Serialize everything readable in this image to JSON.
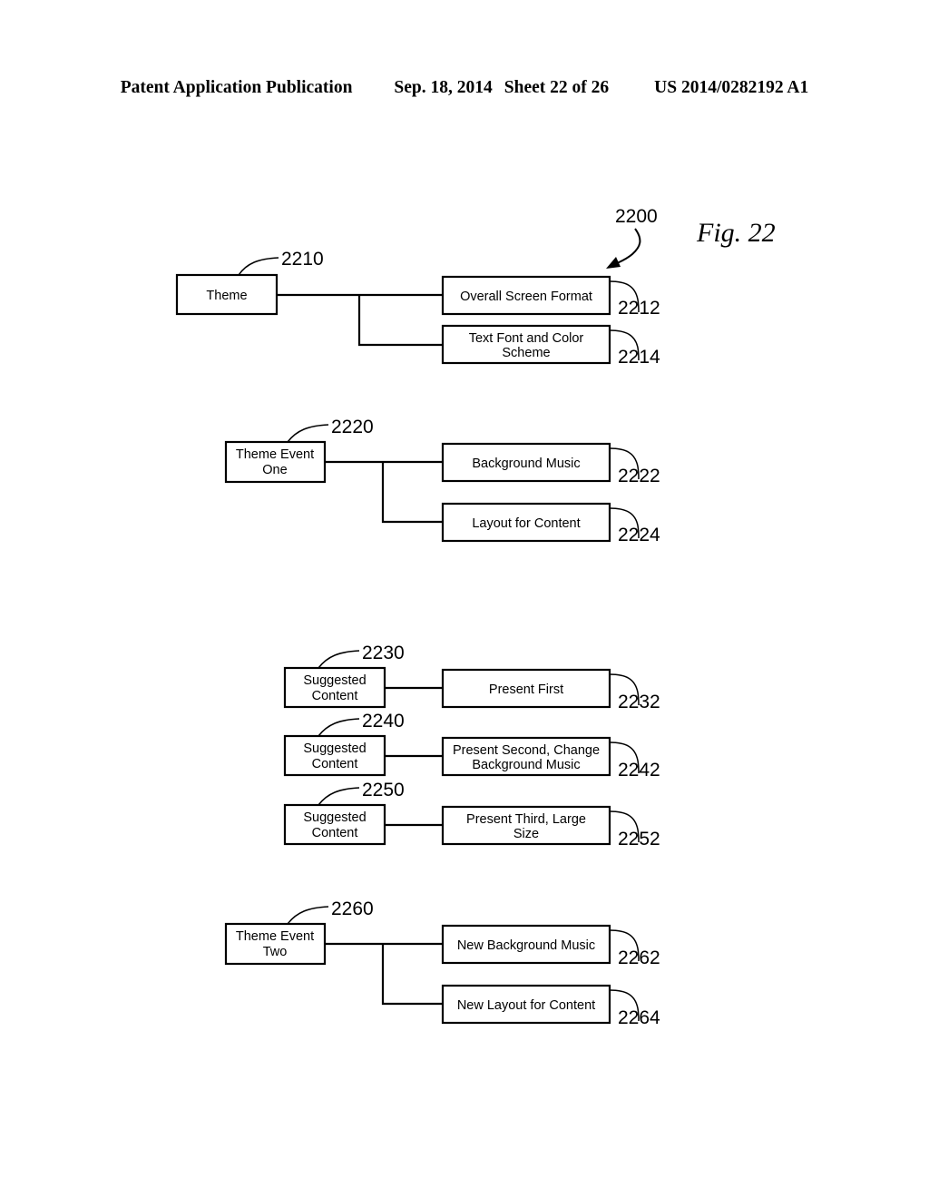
{
  "header": {
    "publication": "Patent Application Publication",
    "date": "Sep. 18, 2014",
    "sheet": "Sheet 22 of 26",
    "patent_number": "US 2014/0282192 A1"
  },
  "figure": {
    "caption": "Fig. 22",
    "figure_ref": "2200",
    "groups": [
      {
        "id": "group-theme",
        "source": {
          "ref": "2210",
          "label": "Theme"
        },
        "targets": [
          {
            "ref": "2212",
            "label": "Overall Screen Format"
          },
          {
            "ref": "2214",
            "label": "Text Font and Color Scheme"
          }
        ]
      },
      {
        "id": "group-theme-event-one",
        "source": {
          "ref": "2220",
          "label": "Theme Event One"
        },
        "targets": [
          {
            "ref": "2222",
            "label": "Background Music"
          },
          {
            "ref": "2224",
            "label": "Layout for Content"
          }
        ]
      },
      {
        "id": "group-suggested-content-first",
        "source": {
          "ref": "2230",
          "label": "Suggested Content"
        },
        "targets": [
          {
            "ref": "2232",
            "label": "Present First"
          }
        ]
      },
      {
        "id": "group-suggested-content-second",
        "source": {
          "ref": "2240",
          "label": "Suggested Content"
        },
        "targets": [
          {
            "ref": "2242",
            "label": "Present Second, Change Background Music"
          }
        ]
      },
      {
        "id": "group-suggested-content-third",
        "source": {
          "ref": "2250",
          "label": "Suggested Content"
        },
        "targets": [
          {
            "ref": "2252",
            "label": "Present Third, Large Size"
          }
        ]
      },
      {
        "id": "group-theme-event-two",
        "source": {
          "ref": "2260",
          "label": "Theme Event Two"
        },
        "targets": [
          {
            "ref": "2262",
            "label": "New Background Music"
          },
          {
            "ref": "2264",
            "label": "New Layout for Content"
          }
        ]
      }
    ],
    "box_text_lines": {
      "theme": [
        "Theme"
      ],
      "overall_screen_format": [
        "Overall Screen Format"
      ],
      "text_font_and_color_scheme": [
        "Text Font and Color",
        "Scheme"
      ],
      "theme_event_one": [
        "Theme Event",
        "One"
      ],
      "background_music": [
        "Background Music"
      ],
      "layout_for_content": [
        "Layout for Content"
      ],
      "suggested_content": [
        "Suggested",
        "Content"
      ],
      "present_first": [
        "Present First"
      ],
      "present_second": [
        "Present Second, Change",
        "Background Music"
      ],
      "present_third": [
        "Present Third, Large",
        "Size"
      ],
      "theme_event_two": [
        "Theme Event",
        "Two"
      ],
      "new_background_music": [
        "New Background Music"
      ],
      "new_layout_for_content": [
        "New Layout for Content"
      ]
    }
  },
  "colors": {
    "ink": "#000000",
    "paper": "#ffffff"
  }
}
